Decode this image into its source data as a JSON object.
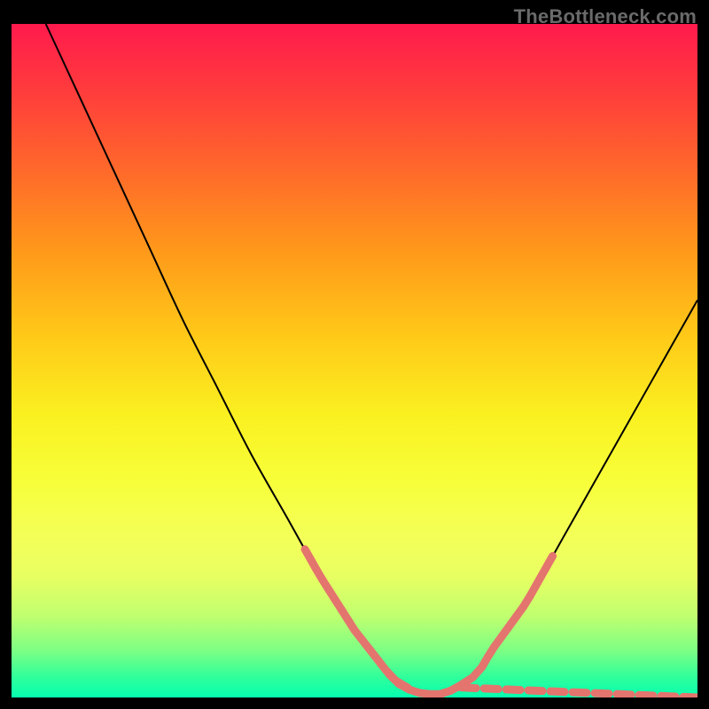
{
  "watermark": "TheBottleneck.com",
  "chart_data": {
    "type": "line",
    "title": "",
    "xlabel": "",
    "ylabel": "",
    "xlim": [
      0,
      100
    ],
    "ylim": [
      0,
      100
    ],
    "series": [
      {
        "name": "curve",
        "x": [
          5,
          10,
          15,
          20,
          25,
          30,
          35,
          40,
          45,
          50,
          55,
          57,
          60,
          63,
          65,
          68,
          70,
          75,
          80,
          85,
          90,
          95,
          100
        ],
        "values": [
          100,
          89,
          78,
          67,
          56,
          46,
          36,
          27,
          18,
          10,
          3.5,
          1.5,
          0.5,
          0.5,
          1.5,
          3.5,
          7,
          14,
          23,
          32,
          41,
          50,
          59
        ]
      }
    ],
    "dash_ranges": [
      {
        "side": "left",
        "y_percent_start": 22,
        "y_percent_end": 0
      },
      {
        "side": "bottom",
        "x_percent_start": 55,
        "x_percent_end": 68
      },
      {
        "side": "right",
        "y_percent_start": 0,
        "y_percent_end": 22
      }
    ],
    "colors": {
      "curve": "#000000",
      "dash": "#e4746e",
      "gradient_top": "#ff1a4d",
      "gradient_bottom": "#06ffb0"
    }
  }
}
